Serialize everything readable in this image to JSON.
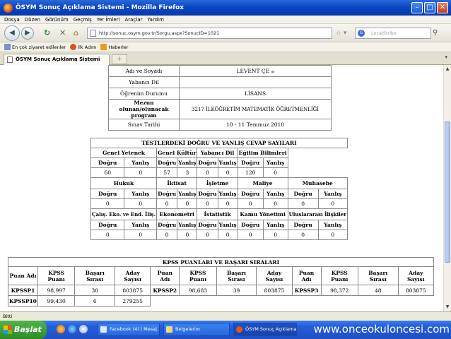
{
  "window": {
    "title": "ÖSYM Sonuç Açıklama Sistemi - Mozilla Firefox"
  },
  "menu": [
    "Dosya",
    "Düzen",
    "Görünüm",
    "Geçmiş",
    "Yer İmleri",
    "Araçlar",
    "Yardım"
  ],
  "nav": {
    "url": "http://sonuc.osym.gov.tr/Sorgu.aspx?SonucID=1021",
    "search_placeholder": "LocalStrike"
  },
  "bookmarks": [
    "En çok ziyaret edilenler",
    "İlk Adım",
    "Haberler"
  ],
  "tabs": [
    {
      "label": "ÖSYM Sonuç Açıklama Sistemi"
    }
  ],
  "status": "Bitti",
  "person": {
    "rows": [
      {
        "label": "Adı ve Soyadı",
        "value": "LEVENT ÇE"
      },
      {
        "label": "Yabancı Dil",
        "value": ""
      },
      {
        "label": "Öğrenim Durumu",
        "value": "LİSANS"
      },
      {
        "label": "Mezun olunan/olunacak program",
        "value": "3217 İLKÖĞRETİM MATEMATİK ÖĞRETMENLİĞİ"
      },
      {
        "label": "Sınav Tarihi",
        "value": "10 - 11 Temmuz 2010"
      }
    ]
  },
  "counts": {
    "title": "TESTLERDEKİ DOĞRU VE YANLIŞ CEVAP SAYILARI",
    "correct": "Doğru",
    "wrong": "Yanlış",
    "section1": {
      "tests": [
        "Genel Yetenek",
        "Genel Kültür",
        "Yabancı Dil",
        "Eğitim Bilimleri"
      ],
      "values": [
        "60",
        "0",
        "57",
        "3",
        "0",
        "0",
        "120",
        "0"
      ]
    },
    "section2": {
      "tests": [
        "Hukuk",
        "İktisat",
        "İşletme",
        "Maliye",
        "Muhasebe"
      ],
      "values": [
        "0",
        "0",
        "0",
        "0",
        "0",
        "0",
        "0",
        "0",
        "0",
        "0"
      ]
    },
    "section3": {
      "tests": [
        "Çalış. Eko. ve End. İliş.",
        "Ekonometri",
        "İstatistik",
        "Kamu Yönetimi",
        "Uluslararası İlişkiler"
      ],
      "values": [
        "0",
        "0",
        "0",
        "0",
        "0",
        "0",
        "0",
        "0",
        "0",
        "0"
      ]
    }
  },
  "scores": {
    "title": "KPSS PUANLARI VE BAŞARI SIRALARI",
    "headers": [
      "Puan Adı",
      "KPSS Puanı",
      "Başarı Sırası",
      "Aday Sayısı"
    ],
    "rows": [
      [
        [
          "KPSSP1",
          "98,997",
          "30",
          "803875"
        ],
        [
          "KPSSP2",
          "98,683",
          "39",
          "803875"
        ],
        [
          "KPSSP3",
          "98,372",
          "48",
          "803875"
        ]
      ],
      [
        [
          "KPSSP10",
          "99,430",
          "6",
          "279255"
        ]
      ]
    ]
  },
  "taskbar": {
    "start": "Başlat",
    "items": [
      "Facebook (4) | Mesaj...",
      "Belgelerim",
      "ÖSYM Sonuç Açıklama..."
    ],
    "watermark": "www.onceokuloncesi.com"
  }
}
